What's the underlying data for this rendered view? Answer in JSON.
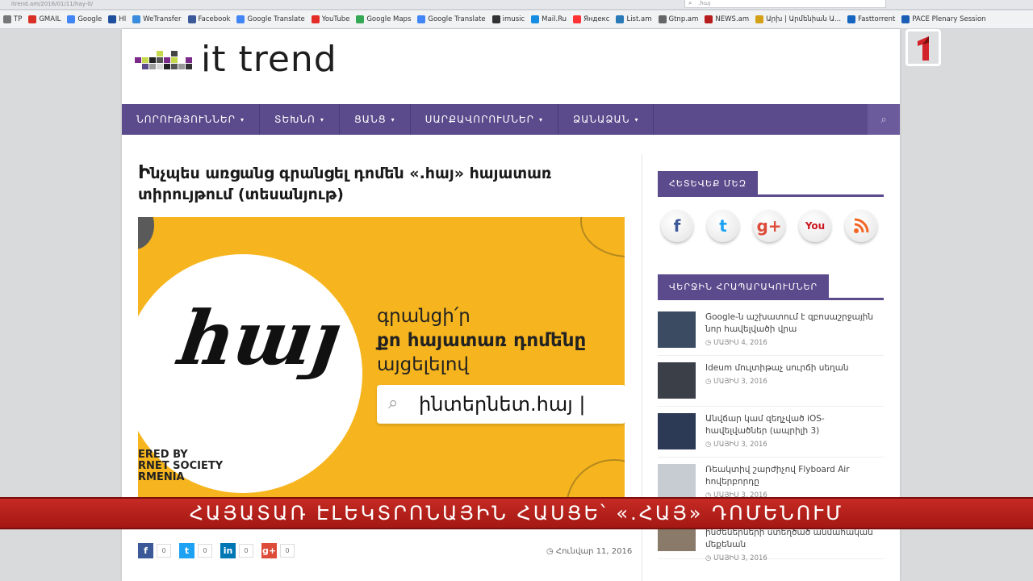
{
  "browser": {
    "url": "itrend.am/2016/01/11/hay-0/",
    "search_value": ".հայ",
    "bookmarks": [
      {
        "label": "TP",
        "color": "#777777"
      },
      {
        "label": "GMAIL",
        "color": "#d93025"
      },
      {
        "label": "Google",
        "color": "#4285f4"
      },
      {
        "label": "HI",
        "color": "#1e4f9c"
      },
      {
        "label": "WeTransfer",
        "color": "#3a8dde"
      },
      {
        "label": "Facebook",
        "color": "#3b5998"
      },
      {
        "label": "Google Translate",
        "color": "#4285f4"
      },
      {
        "label": "YouTube",
        "color": "#e52d27"
      },
      {
        "label": "Google Maps",
        "color": "#34a853"
      },
      {
        "label": "Google Translate",
        "color": "#4285f4"
      },
      {
        "label": "imusic",
        "color": "#333333"
      },
      {
        "label": "Mail.Ru",
        "color": "#168de2"
      },
      {
        "label": "Яндекс",
        "color": "#ff3333"
      },
      {
        "label": "List.am",
        "color": "#2a7ab8"
      },
      {
        "label": "Gtnp.am",
        "color": "#666666"
      },
      {
        "label": "NEWS.am",
        "color": "#b71c1c"
      },
      {
        "label": "Արխ | Արմենիան Ա...",
        "color": "#d4a017"
      },
      {
        "label": "Fasttorrent",
        "color": "#1565c0"
      },
      {
        "label": "PACE Plenary Session",
        "color": "#1a5fb4"
      }
    ]
  },
  "site": {
    "logo_text": "it trend",
    "nav": [
      "ՆՈՐՈՒԹՅՈՒՆՆԵՐ",
      "ՏԵԽՆՈ",
      "ՑԱՆՑ",
      "ՍԱՐՔԱՎՈՐՈՒՄՆԵՐ",
      "ՁԱՆԱՁԱՆ"
    ]
  },
  "article": {
    "title_initial": "Ի",
    "title_rest": "նչպես առցանց գրանցել դոմեն «.հայ» հայատառ տիրույթում (տեսանյութ)",
    "hero": {
      "logo_word": "հայ",
      "line1": "գրանցի՛ր",
      "line2": "քո հայատառ դոմենը",
      "line3": "այցելելով",
      "search_text": "ինտերնետ.հայ |",
      "sponsor_line1": "ERED BY",
      "sponsor_line2": "RNET SOCIETY",
      "sponsor_line3": "RMENIA"
    },
    "share": [
      {
        "icon": "f",
        "count": "0",
        "color": "#3b5998"
      },
      {
        "icon": "t",
        "count": "0",
        "color": "#1da1f2"
      },
      {
        "icon": "in",
        "count": "0",
        "color": "#0077b5"
      },
      {
        "icon": "g+",
        "count": "0",
        "color": "#dd4b39"
      }
    ],
    "date": "Հունվար 11, 2016"
  },
  "sidebar": {
    "follow_title": "ՀԵՏԵՎԵՔ ՄԵԶ",
    "social": [
      {
        "glyph": "f",
        "color": "#3b5998"
      },
      {
        "glyph": "t",
        "color": "#1da1f2"
      },
      {
        "glyph": "g+",
        "color": "#dd4b39"
      },
      {
        "glyph": "You",
        "color": "#cc181e"
      },
      {
        "glyph": "rss",
        "color": "#f26522"
      }
    ],
    "latest_title": "ՎԵՐՋԻՆ ՀՐԱՊԱՐԱԿՈՒՄՆԵՐ",
    "posts": [
      {
        "title": "Google-ն աշխատում է զբոսաշրջային նոր հավելվածի վրա",
        "date": "ՄԱՅԻՍ 4, 2016",
        "thumb": "#3a4b62"
      },
      {
        "title": "Ideum մուլտիթաչ սուրճի սեղան",
        "date": "ՄԱՅԻՍ 3, 2016",
        "thumb": "#3b3f48"
      },
      {
        "title": "Անվճար կամ զեղչված iOS-հավելվածներ (ապրիլի 3)",
        "date": "ՄԱՅԻՍ 3, 2016",
        "thumb": "#2c3a56"
      },
      {
        "title": "Ռեակտիվ շարժիչով Flyboard Air hովերբորդը",
        "date": "ՄԱՅԻՍ 3, 2016",
        "thumb": "#c7ccd2"
      },
      {
        "title": "«Նաիրի». տաղանդավոր հայ ինժեներների ստեղծած անմահական մեքենան",
        "date": "ՄԱՅԻՍ 3, 2016",
        "thumb": "#8a7a6a"
      }
    ]
  },
  "overlay": {
    "ticker": "ՀԱՅԱՏԱՌ ԷԼԵԿՏՐՈՆԱՅԻՆ ՀԱՍՑԵ՝ «.ՀԱՅ» ԴՈՄԵՆՈՒՄ"
  }
}
